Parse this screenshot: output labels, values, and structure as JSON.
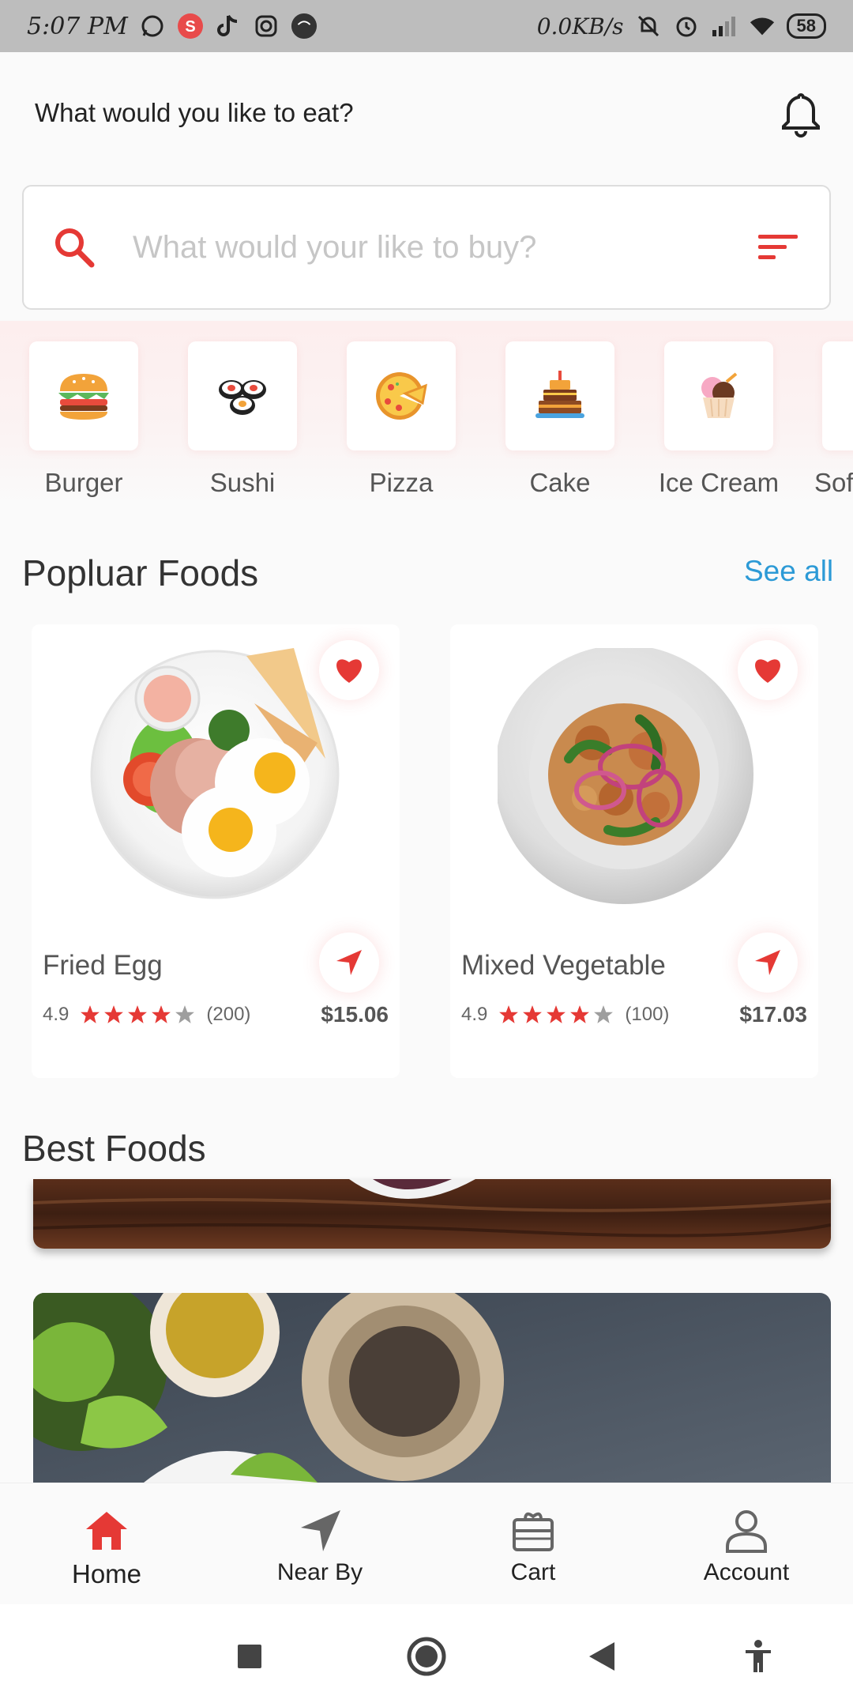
{
  "status_bar": {
    "time": "5:07 PM",
    "speed": "0.0KB/s",
    "battery": "58"
  },
  "header": {
    "title": "What would you like to eat?"
  },
  "search": {
    "placeholder": "What would your like to buy?"
  },
  "categories": [
    {
      "label": "Burger",
      "icon": "burger-icon"
    },
    {
      "label": "Sushi",
      "icon": "sushi-icon"
    },
    {
      "label": "Pizza",
      "icon": "pizza-icon"
    },
    {
      "label": "Cake",
      "icon": "cake-icon"
    },
    {
      "label": "Ice Cream",
      "icon": "ice-cream-icon"
    },
    {
      "label": "Sof",
      "icon": "soft-drink-icon"
    }
  ],
  "popular": {
    "title": "Popluar Foods",
    "see_all": "See all",
    "items": [
      {
        "name": "Fried Egg",
        "rating": "4.9",
        "reviews": "(200)",
        "price": "$15.06",
        "stars": 4
      },
      {
        "name": "Mixed Vegetable",
        "rating": "4.9",
        "reviews": "(100)",
        "price": "$17.03",
        "stars": 4
      }
    ]
  },
  "best": {
    "title": "Best Foods"
  },
  "bottom_nav": [
    {
      "label": "Home",
      "icon": "home-icon",
      "active": true
    },
    {
      "label": "Near By",
      "icon": "navigation-icon"
    },
    {
      "label": "Cart",
      "icon": "cart-icon"
    },
    {
      "label": "Account",
      "icon": "account-icon"
    }
  ],
  "colors": {
    "accent": "#e53935",
    "link": "#2c9ad6",
    "status_bar": "#bdbdbd"
  }
}
